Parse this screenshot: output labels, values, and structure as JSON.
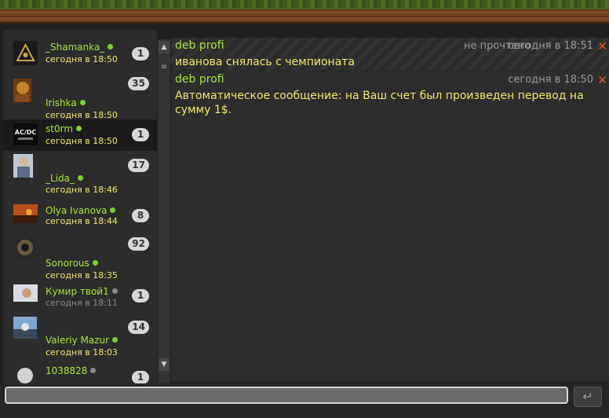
{
  "contacts": [
    {
      "name": "_Shamanka_",
      "time": "сегодня в 18:50",
      "count": "1",
      "online": true
    },
    {
      "name": "Irishka",
      "time": "сегодня в 18:50",
      "count": "35",
      "online": true
    },
    {
      "name": "st0rm",
      "time": "сегодня в 18:50",
      "count": "1",
      "online": true
    },
    {
      "name": "_Lida_",
      "time": "сегодня в 18:46",
      "count": "17",
      "online": true
    },
    {
      "name": "Olya Ivanova",
      "time": "сегодня в 18:44",
      "count": "8",
      "online": true
    },
    {
      "name": "Sonorous",
      "time": "сегодня в 18:35",
      "count": "92",
      "online": true
    },
    {
      "name": "Кумир твой1",
      "time": "сегодня в 18:11",
      "count": "1",
      "online": false
    },
    {
      "name": "Valeriy Mazur",
      "time": "сегодня в 18:03",
      "count": "14",
      "online": true
    },
    {
      "name": "1038828",
      "time": "",
      "count": "1",
      "online": false
    }
  ],
  "messages": [
    {
      "sender": "deb profi",
      "status": "не прочтено",
      "time": "сегодня в 18:51",
      "text": "иванова снялась с чемпионата",
      "unread": true
    },
    {
      "sender": "deb profi",
      "status": "",
      "time": "сегодня в 18:50",
      "text": "Автоматическое сообщение: на Ваш счет был произведен перевод на сумму 1$.",
      "unread": false
    }
  ],
  "icons": {
    "scroll_up": "▲",
    "scroll_down": "▼",
    "scroll_thumb": "≡",
    "delete": "✕",
    "send": "↵"
  },
  "input": {
    "value": ""
  }
}
